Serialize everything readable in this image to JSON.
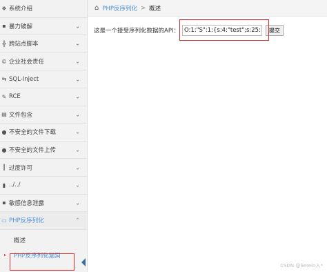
{
  "sidebar": {
    "items": [
      {
        "icon": "chat-icon",
        "glyph": "❖",
        "label": "系统介绍"
      },
      {
        "icon": "lock-icon",
        "glyph": "▪",
        "label": "暴力破解"
      },
      {
        "icon": "network-icon",
        "glyph": "╬",
        "label": "跨站点脚本"
      },
      {
        "icon": "copyright-icon",
        "glyph": "©",
        "label": "企业社会责任"
      },
      {
        "icon": "code-icon",
        "glyph": "⇆",
        "label": "SQL-Inject"
      },
      {
        "icon": "pencil-icon",
        "glyph": "✎",
        "label": "RCE"
      },
      {
        "icon": "file-icon",
        "glyph": "▤",
        "label": "文件包含"
      },
      {
        "icon": "download-icon",
        "glyph": "●",
        "label": "不安全的文件下载"
      },
      {
        "icon": "upload-icon",
        "glyph": "●",
        "label": "不安全的文件上传"
      },
      {
        "icon": "stack-icon",
        "glyph": "┃",
        "label": "过度许可"
      },
      {
        "icon": "bars-icon",
        "glyph": "▮",
        "label": "../../"
      },
      {
        "icon": "eye-icon",
        "glyph": "▪",
        "label": "敏感信息泄露"
      },
      {
        "icon": "monitor-icon",
        "glyph": "▭",
        "label": "PHP反序列化"
      }
    ],
    "subitems": [
      {
        "label": "概述"
      },
      {
        "label": "PHP反序列化漏洞"
      }
    ]
  },
  "breadcrumb": {
    "link": "PHP反序列化",
    "separator": ">",
    "current": "概述"
  },
  "main": {
    "prompt": "这是一个接受序列化数据的API：",
    "input_value": "O:1:\"S\":1:{s:4:\"test\";s:25:\"",
    "submit_label": "提交"
  },
  "watermark": "CSDN @Serein入*",
  "colors": {
    "accent": "#4a8fd6",
    "highlight_box": "#d62c2c"
  }
}
